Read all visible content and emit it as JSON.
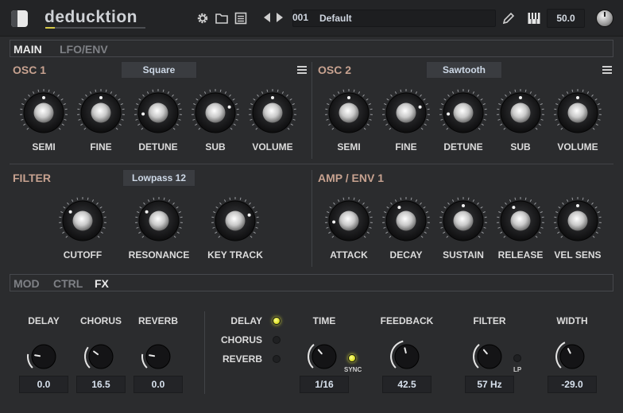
{
  "header": {
    "title": "deducktion",
    "preset_number": "001",
    "preset_name": "Default",
    "tempo": "50.0",
    "icons": [
      "gear-icon",
      "folder-icon",
      "list-icon",
      "prev-arrow-icon",
      "next-arrow-icon",
      "pencil-icon",
      "piano-icon",
      "master-knob"
    ]
  },
  "top_tabs": [
    "MAIN",
    "LFO/ENV"
  ],
  "osc1": {
    "title": "OSC 1",
    "waveform": "Square",
    "knobs": [
      {
        "label": "SEMI",
        "value": 0.5
      },
      {
        "label": "FINE",
        "value": 0.5
      },
      {
        "label": "DETUNE",
        "value": 0.15
      },
      {
        "label": "SUB",
        "value": 0.75
      },
      {
        "label": "VOLUME",
        "value": 0.5
      }
    ]
  },
  "osc2": {
    "title": "OSC 2",
    "waveform": "Sawtooth",
    "knobs": [
      {
        "label": "SEMI",
        "value": 0.5
      },
      {
        "label": "FINE",
        "value": 0.75
      },
      {
        "label": "DETUNE",
        "value": 0.15
      },
      {
        "label": "SUB",
        "value": 0.5
      },
      {
        "label": "VOLUME",
        "value": 0.5
      }
    ]
  },
  "filter": {
    "title": "FILTER",
    "type": "Lowpass 12",
    "knobs": [
      {
        "label": "CUTOFF",
        "value": 0.3
      },
      {
        "label": "RESONANCE",
        "value": 0.3
      },
      {
        "label": "KEY TRACK",
        "value": 0.75
      }
    ]
  },
  "amp": {
    "title": "AMP / ENV 1",
    "knobs": [
      {
        "label": "ATTACK",
        "value": 0.15
      },
      {
        "label": "DECAY",
        "value": 0.4
      },
      {
        "label": "SUSTAIN",
        "value": 0.5
      },
      {
        "label": "RELEASE",
        "value": 0.4
      },
      {
        "label": "VEL SENS",
        "value": 0.5
      }
    ]
  },
  "bottom_tabs": [
    "MOD",
    "CTRL",
    "FX"
  ],
  "fx": {
    "mix_knobs": [
      {
        "label": "DELAY",
        "value": "0.0",
        "pos": 0.2
      },
      {
        "label": "CHORUS",
        "value": "16.5",
        "pos": 0.3
      },
      {
        "label": "REVERB",
        "value": "0.0",
        "pos": 0.2
      }
    ],
    "toggles": [
      {
        "label": "DELAY",
        "on": true
      },
      {
        "label": "CHORUS",
        "on": false
      },
      {
        "label": "REVERB",
        "on": false
      }
    ],
    "params": [
      {
        "label": "TIME",
        "value": "1/16",
        "pos": 0.35,
        "extra": "SYNC",
        "extra_on": true
      },
      {
        "label": "FEEDBACK",
        "value": "42.5",
        "pos": 0.45
      },
      {
        "label": "FILTER",
        "value": "57 Hz",
        "pos": 0.35,
        "extra": "LP",
        "extra_on": false
      },
      {
        "label": "WIDTH",
        "value": "-29.0",
        "pos": 0.4
      }
    ]
  }
}
